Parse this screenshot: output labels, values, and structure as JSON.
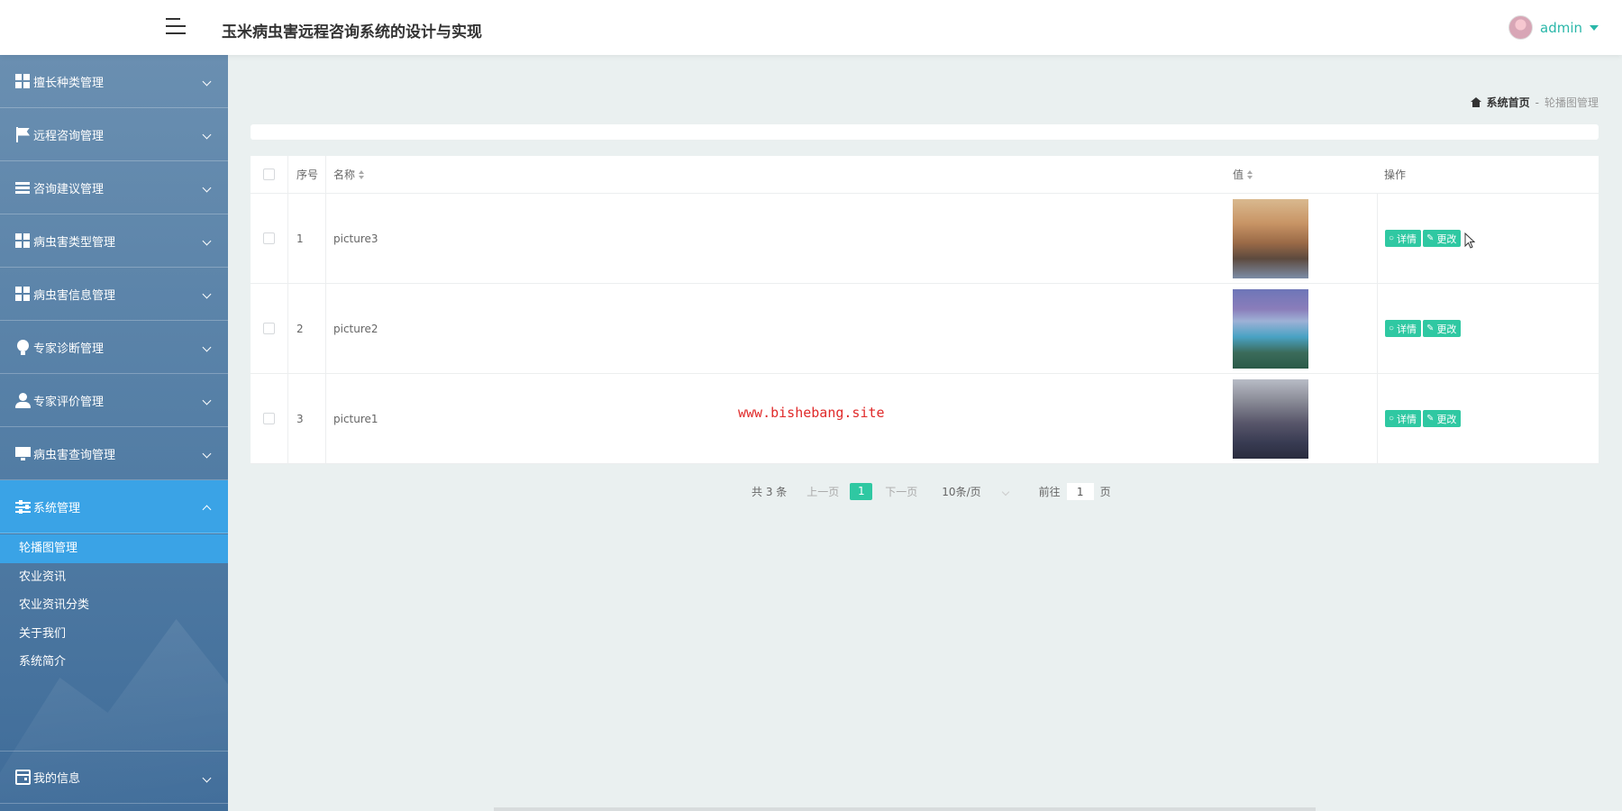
{
  "header": {
    "title": "玉米病虫害远程咨询系统的设计与实现",
    "user_name": "admin"
  },
  "sidebar": {
    "items": [
      {
        "label": "擅长种类管理",
        "icon": "grid-icon"
      },
      {
        "label": "远程咨询管理",
        "icon": "flag-icon"
      },
      {
        "label": "咨询建议管理",
        "icon": "list-icon"
      },
      {
        "label": "病虫害类型管理",
        "icon": "grid-icon"
      },
      {
        "label": "病虫害信息管理",
        "icon": "grid-icon"
      },
      {
        "label": "专家诊断管理",
        "icon": "bulb-icon"
      },
      {
        "label": "专家评价管理",
        "icon": "user-icon"
      },
      {
        "label": "病虫害查询管理",
        "icon": "monitor-icon"
      },
      {
        "label": "系统管理",
        "icon": "sliders-icon"
      }
    ],
    "submenu": [
      "轮播图管理",
      "农业资讯",
      "农业资讯分类",
      "关于我们",
      "系统简介"
    ],
    "last_item": {
      "label": "我的信息",
      "icon": "wallet-icon"
    },
    "active_color": "#3aa3e6"
  },
  "breadcrumb": {
    "home": "系统首页",
    "separator": "-",
    "current": "轮播图管理"
  },
  "table": {
    "columns": {
      "index": "序号",
      "name": "名称",
      "value": "值",
      "actions": "操作"
    },
    "rows": [
      {
        "index": "1",
        "name": "picture3",
        "image": "city-skyline"
      },
      {
        "index": "2",
        "name": "picture2",
        "image": "lake-mountains"
      },
      {
        "index": "3",
        "name": "picture1",
        "image": "city-night"
      }
    ],
    "detail_label": "详情",
    "edit_label": "更改"
  },
  "watermark": "www.bishebang.site",
  "pagination": {
    "total": "共 3 条",
    "prev": "上一页",
    "current_page": "1",
    "next": "下一页",
    "page_size": "10条/页",
    "goto": "前往",
    "goto_value": "1",
    "page_unit": "页"
  },
  "colors": {
    "accent": "#2fc8a2",
    "brand_text": "#2ab7a9"
  }
}
